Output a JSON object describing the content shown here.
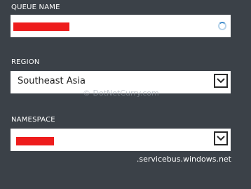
{
  "queue_name": {
    "label": "QUEUE NAME",
    "status_icon": "loading-spinner-icon"
  },
  "region": {
    "label": "REGION",
    "selected": "Southeast Asia",
    "dropdown_icon": "chevron-down-icon"
  },
  "namespace": {
    "label": "NAMESPACE",
    "suffix": ".servicebus.windows.net",
    "dropdown_icon": "chevron-down-icon"
  },
  "watermark": "© DotNetCurry.com",
  "colors": {
    "background": "#3b4148",
    "field": "#ffffff",
    "redaction": "#ee1c1c"
  }
}
